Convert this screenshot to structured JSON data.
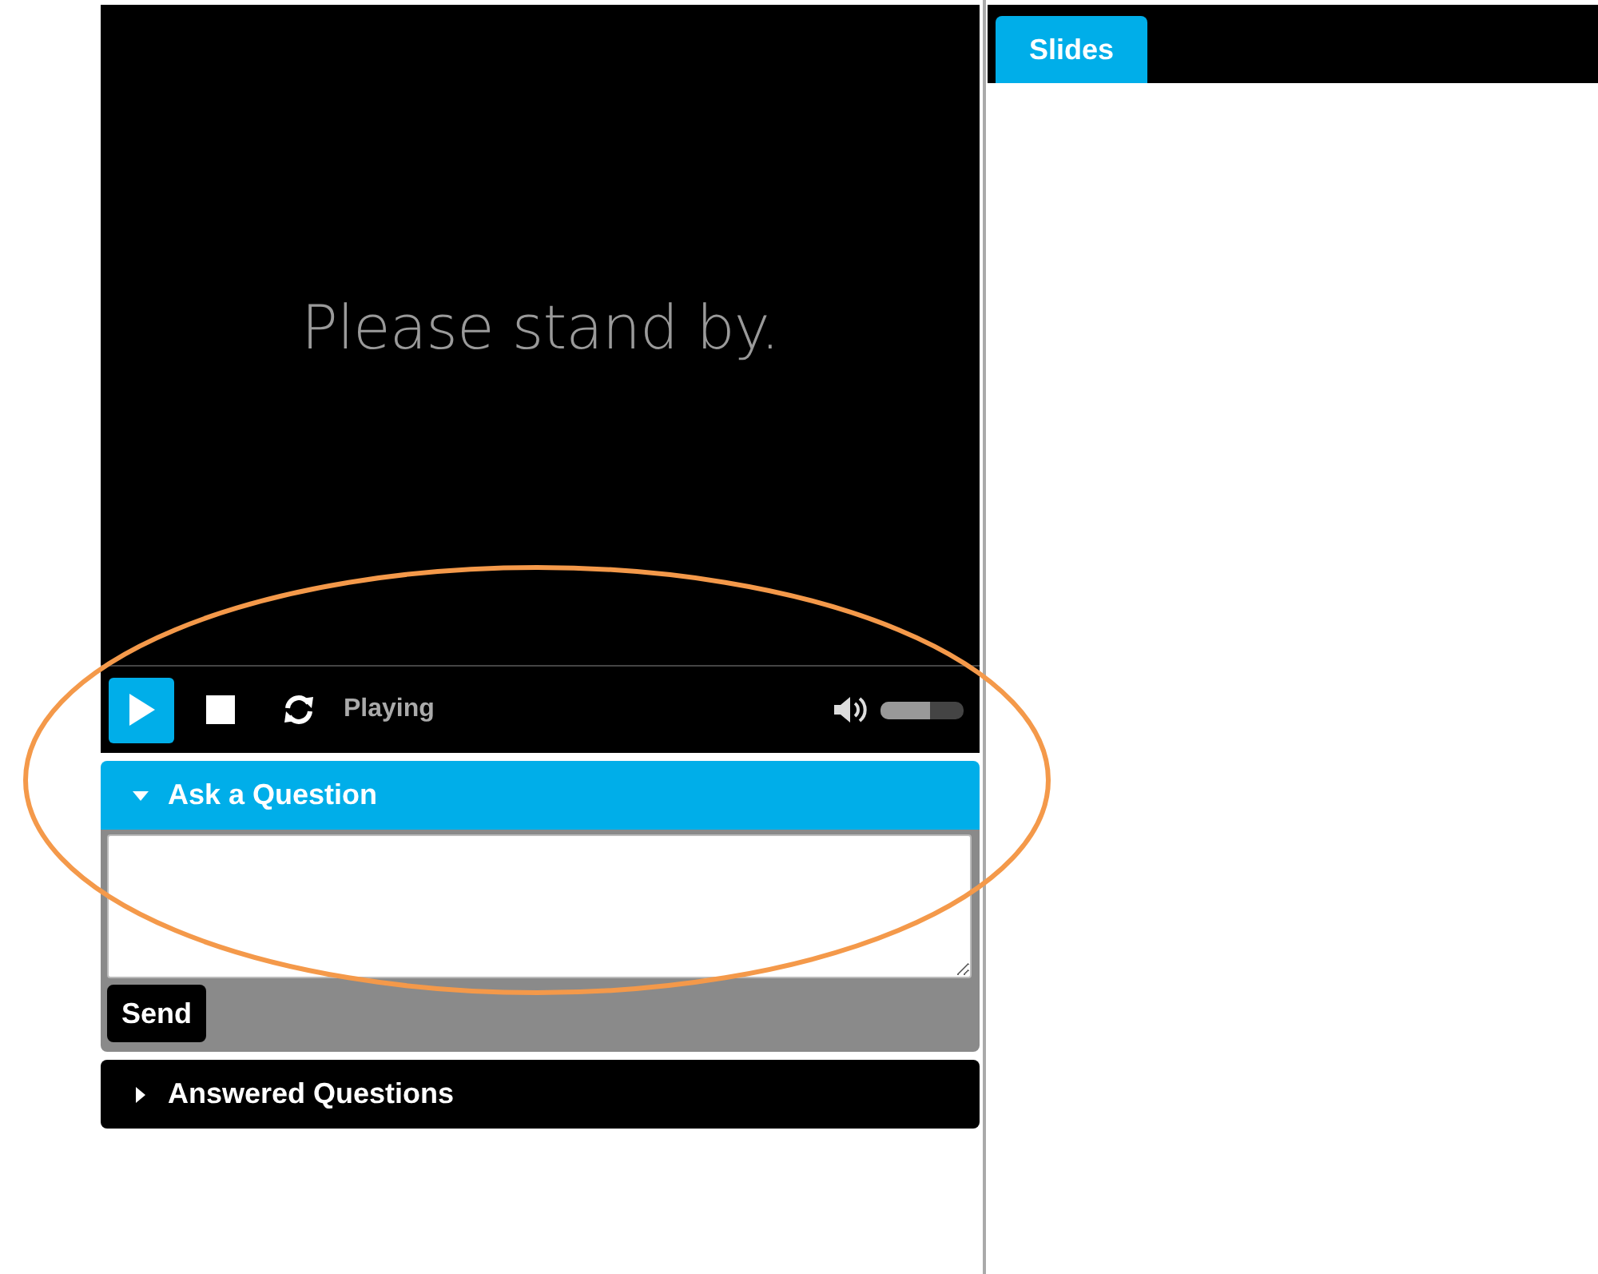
{
  "video": {
    "message": "Please stand by."
  },
  "player": {
    "playing": true,
    "status": "Playing",
    "volume": {
      "level": 0.6
    }
  },
  "ask_panel": {
    "title": "Ask a Question",
    "expanded": true,
    "send_button": "Send"
  },
  "answered_panel": {
    "title": "Answered Questions",
    "expanded": false
  },
  "tabs": [
    {
      "label": "Slides",
      "selected": true
    }
  ]
}
